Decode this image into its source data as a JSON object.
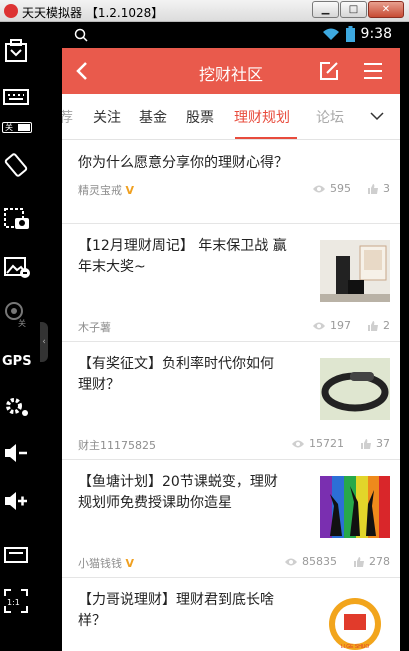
{
  "emulator": {
    "title": "天天模拟器 【1.2.1028】",
    "sidebar": {
      "toggle_label": "关",
      "gps_label": "GPS",
      "camera_label": "关",
      "ratio_label": "1:1"
    }
  },
  "phone": {
    "status_time": "9:38",
    "app_title": "挖财社区",
    "tabs": [
      {
        "label": "荐",
        "state": "faded"
      },
      {
        "label": "关注",
        "state": "normal"
      },
      {
        "label": "基金",
        "state": "normal"
      },
      {
        "label": "股票",
        "state": "normal"
      },
      {
        "label": "理财规划",
        "state": "active"
      },
      {
        "label": "论坛",
        "state": "faded"
      }
    ],
    "posts": [
      {
        "title": "你为什么愿意分享你的理财心得？",
        "author": "精灵宝戒",
        "vip": "V",
        "views": "595",
        "likes": "3"
      },
      {
        "title_line1": "【12月理财周记】 年末保卫战 赢",
        "title_line2": "年末大奖~",
        "author": "木子薯",
        "views": "197",
        "likes": "2",
        "thumb": "gift-bags"
      },
      {
        "title_line1": "【有奖征文】负利率时代你如何",
        "title_line2": "理财？",
        "author": "财主11175825",
        "views": "15721",
        "likes": "37",
        "thumb": "fitness-band"
      },
      {
        "title_line1": "【鱼塘计划】20节课蜕变，理财",
        "title_line2": "规划师免费授课助你造星",
        "author": "小猫钱钱",
        "vip": "V",
        "views": "85835",
        "likes": "278",
        "thumb": "dancers"
      },
      {
        "title_line1": "【力哥说理财】理财君到底长啥",
        "title_line2": "样？",
        "thumb": "badge",
        "badge_text": "LI GE SHUO"
      }
    ]
  },
  "colors": {
    "accent": "#e95a4c",
    "active_tab": "#e84c3d",
    "vip": "#f0a020"
  }
}
